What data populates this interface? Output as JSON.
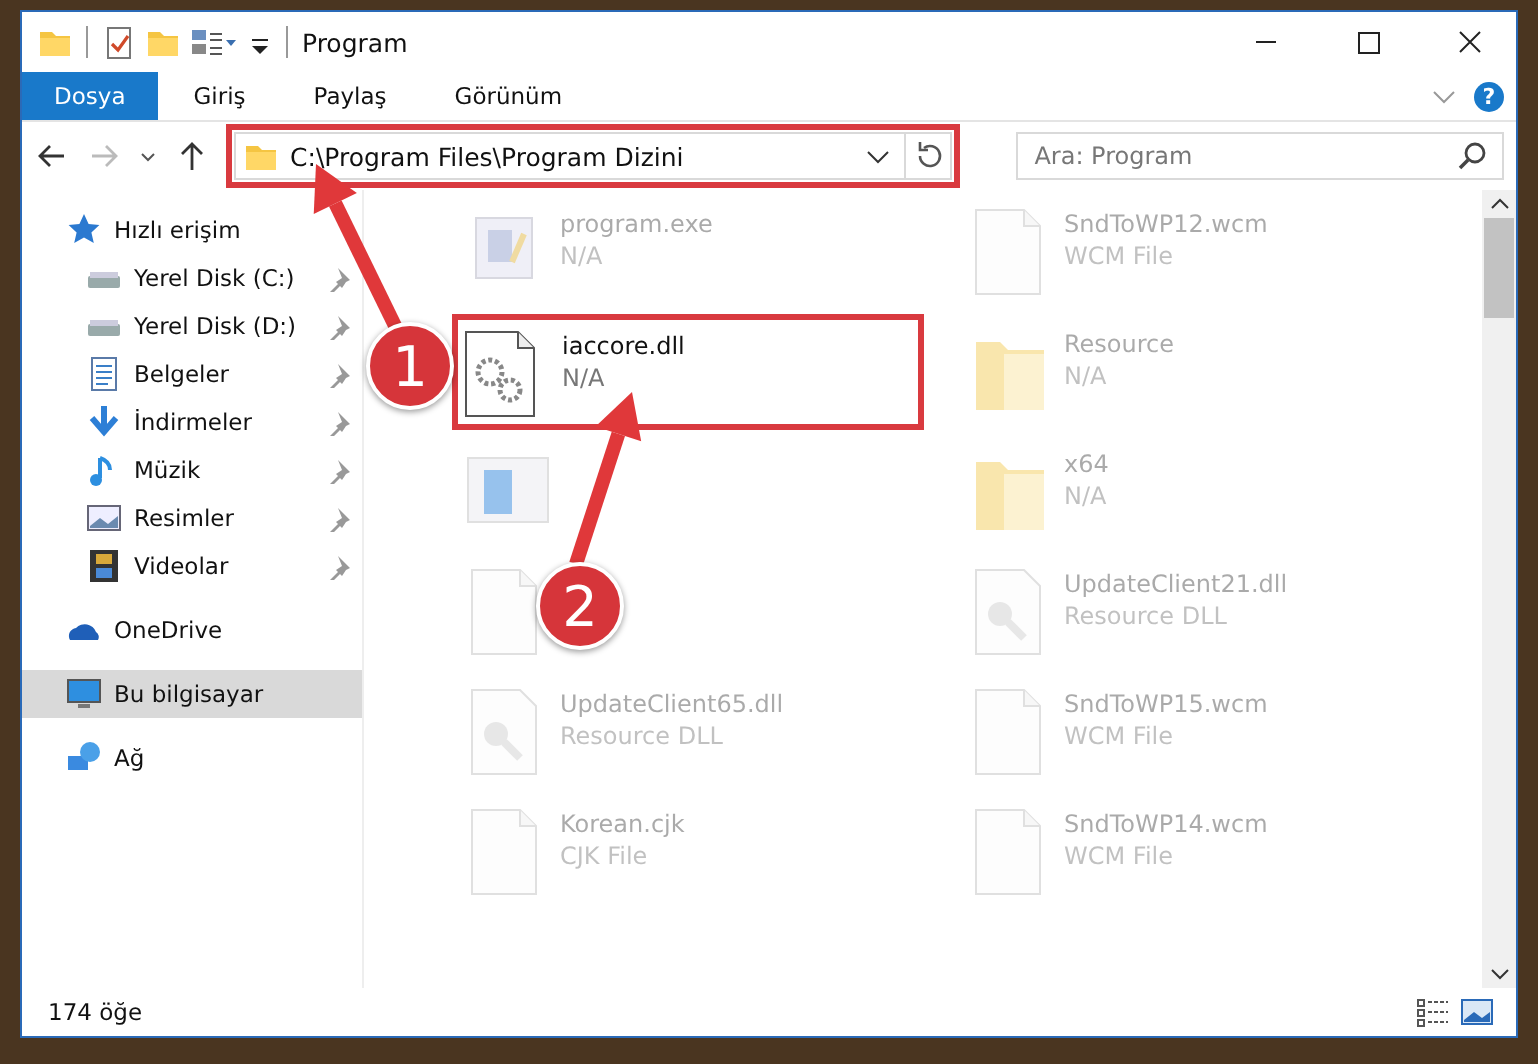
{
  "window": {
    "title": "Program"
  },
  "ribbon": {
    "tabs": [
      {
        "label": "Dosya",
        "selected": true
      },
      {
        "label": "Giriş",
        "selected": false
      },
      {
        "label": "Paylaş",
        "selected": false
      },
      {
        "label": "Görünüm",
        "selected": false
      }
    ],
    "help": "?"
  },
  "address": {
    "path": "C:\\Program Files\\Program Dizini",
    "highlighted": true
  },
  "search": {
    "placeholder": "Ara: Program"
  },
  "sidebar": {
    "items": [
      {
        "label": "Hızlı erişim",
        "kind": "star",
        "selected": false,
        "children": [
          {
            "label": "Yerel Disk (C:)",
            "kind": "drive",
            "pinned": true,
            "selected": false
          },
          {
            "label": "Yerel Disk (D:)",
            "kind": "drive",
            "pinned": true,
            "selected": false
          },
          {
            "label": "Belgeler",
            "kind": "doc",
            "pinned": true,
            "selected": false
          },
          {
            "label": "İndirmeler",
            "kind": "download",
            "pinned": true,
            "selected": false
          },
          {
            "label": "Müzik",
            "kind": "music",
            "pinned": true,
            "selected": false
          },
          {
            "label": "Resimler",
            "kind": "picture",
            "pinned": true,
            "selected": false
          },
          {
            "label": "Videolar",
            "kind": "film",
            "pinned": true,
            "selected": false
          }
        ]
      },
      {
        "label": "OneDrive",
        "kind": "cloud",
        "selected": false
      },
      {
        "label": "Bu bilgisayar",
        "kind": "computer",
        "selected": true
      },
      {
        "label": "Ağ",
        "kind": "network",
        "selected": false
      }
    ]
  },
  "files": [
    {
      "name": "program.exe",
      "type": "N/A",
      "kind": "app",
      "faded": true,
      "highlighted": false
    },
    {
      "name": "SndToWP12.wcm",
      "type": "WCM File",
      "kind": "blank",
      "faded": true,
      "highlighted": false
    },
    {
      "name": "iaccore.dll",
      "type": "N/A",
      "kind": "gears",
      "faded": false,
      "highlighted": true
    },
    {
      "name": "Resource",
      "type": "N/A",
      "kind": "folder",
      "faded": true,
      "highlighted": false
    },
    {
      "kind": "installer",
      "faded": true,
      "highlighted": false
    },
    {
      "name": "x64",
      "type": "N/A",
      "kind": "folder",
      "faded": true,
      "highlighted": false
    },
    {
      "kind": "blank",
      "faded": true,
      "highlighted": false
    },
    {
      "name": "UpdateClient21.dll",
      "type": "Resource DLL",
      "kind": "dll",
      "faded": true,
      "highlighted": false
    },
    {
      "name": "UpdateClient65.dll",
      "type": "Resource DLL",
      "kind": "dll",
      "faded": true,
      "highlighted": false
    },
    {
      "name": "SndToWP15.wcm",
      "type": "WCM File",
      "kind": "blank",
      "faded": true,
      "highlighted": false
    },
    {
      "name": "Korean.cjk",
      "type": "CJK File",
      "kind": "blank",
      "faded": true,
      "highlighted": false
    },
    {
      "name": "SndToWP14.wcm",
      "type": "WCM File",
      "kind": "blank",
      "faded": true,
      "highlighted": false
    }
  ],
  "annotations": [
    {
      "label": "1"
    },
    {
      "label": "2"
    }
  ],
  "status_bar": {
    "count": "174 öğe"
  }
}
